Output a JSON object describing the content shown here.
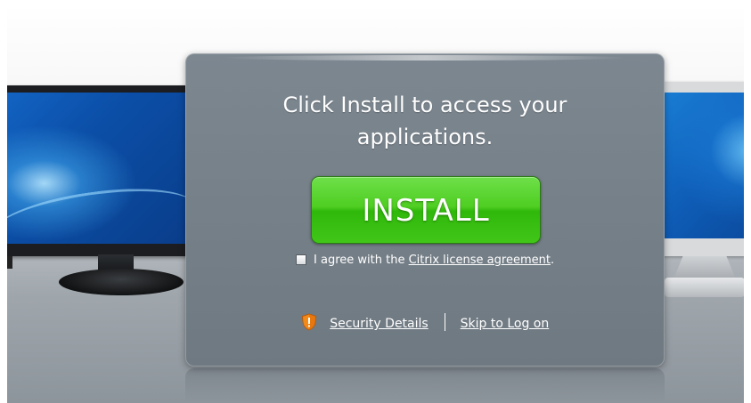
{
  "panel": {
    "heading": "Click Install to access your applications.",
    "install_label": "INSTALL",
    "agree_prefix": "I agree with the",
    "agree_link": "Citrix license agreement",
    "agree_suffix": ".",
    "agree_checked": false,
    "security_link": "Security Details",
    "skip_link": "Skip to Log on"
  },
  "icons": {
    "shield": "shield-warning-icon"
  },
  "colors": {
    "panel_bg": "#77818a",
    "install_green": "#41c618",
    "shield_orange": "#f28a1a"
  }
}
